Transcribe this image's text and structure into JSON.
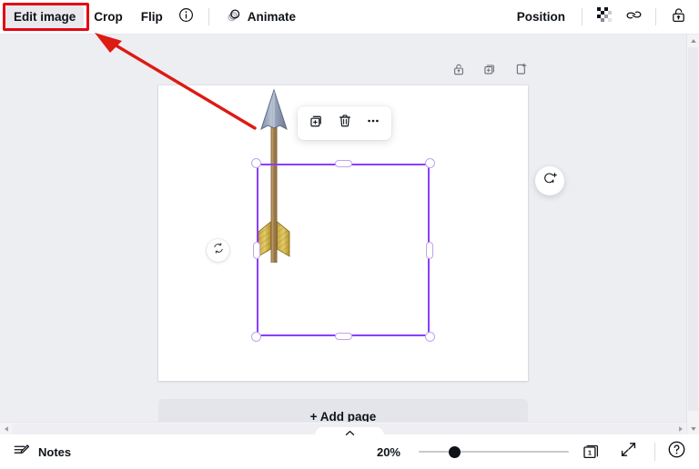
{
  "toolbar": {
    "edit_image_label": "Edit image",
    "crop_label": "Crop",
    "flip_label": "Flip",
    "info_icon": "info-circle-icon",
    "animate_icon": "animate-icon",
    "animate_label": "Animate",
    "position_label": "Position",
    "transparency_icon": "transparency-checker-icon",
    "link_icon": "link-icon",
    "lock_icon": "unlock-icon"
  },
  "page_tools": {
    "lock_icon": "unlock-page-icon",
    "duplicate_icon": "duplicate-page-icon",
    "add_icon": "add-page-icon"
  },
  "context_toolbar": {
    "duplicate_icon": "duplicate-element-icon",
    "delete_icon": "trash-icon",
    "more_icon": "more-options-icon"
  },
  "canvas": {
    "rotate_left_icon": "flip-rotate-icon",
    "rotate_right_icon": "add-comment-rotate-icon",
    "element_name": "arrow-graphic",
    "selection_color": "#8B3DFF",
    "handle_color": "#FFFFFF"
  },
  "add_page": {
    "label": "+ Add page"
  },
  "bottom_bar": {
    "notes_icon": "notes-icon",
    "notes_label": "Notes",
    "zoom_level": "20%",
    "zoom_slider_value": 24,
    "page_number": "1",
    "fullscreen_icon": "expand-icon",
    "help_icon": "help-circle-icon"
  },
  "annotation": {
    "highlight_target": "edit-image-button",
    "highlight_color": "#E30613",
    "arrow_color": "#DD1A13"
  },
  "scrollbars": {
    "vertical_up_icon": "scroll-up-icon",
    "vertical_down_icon": "scroll-down-icon",
    "horizontal_left_icon": "scroll-left-icon",
    "horizontal_right_icon": "scroll-right-icon",
    "panel_toggle_icon": "chevron-up-icon"
  }
}
